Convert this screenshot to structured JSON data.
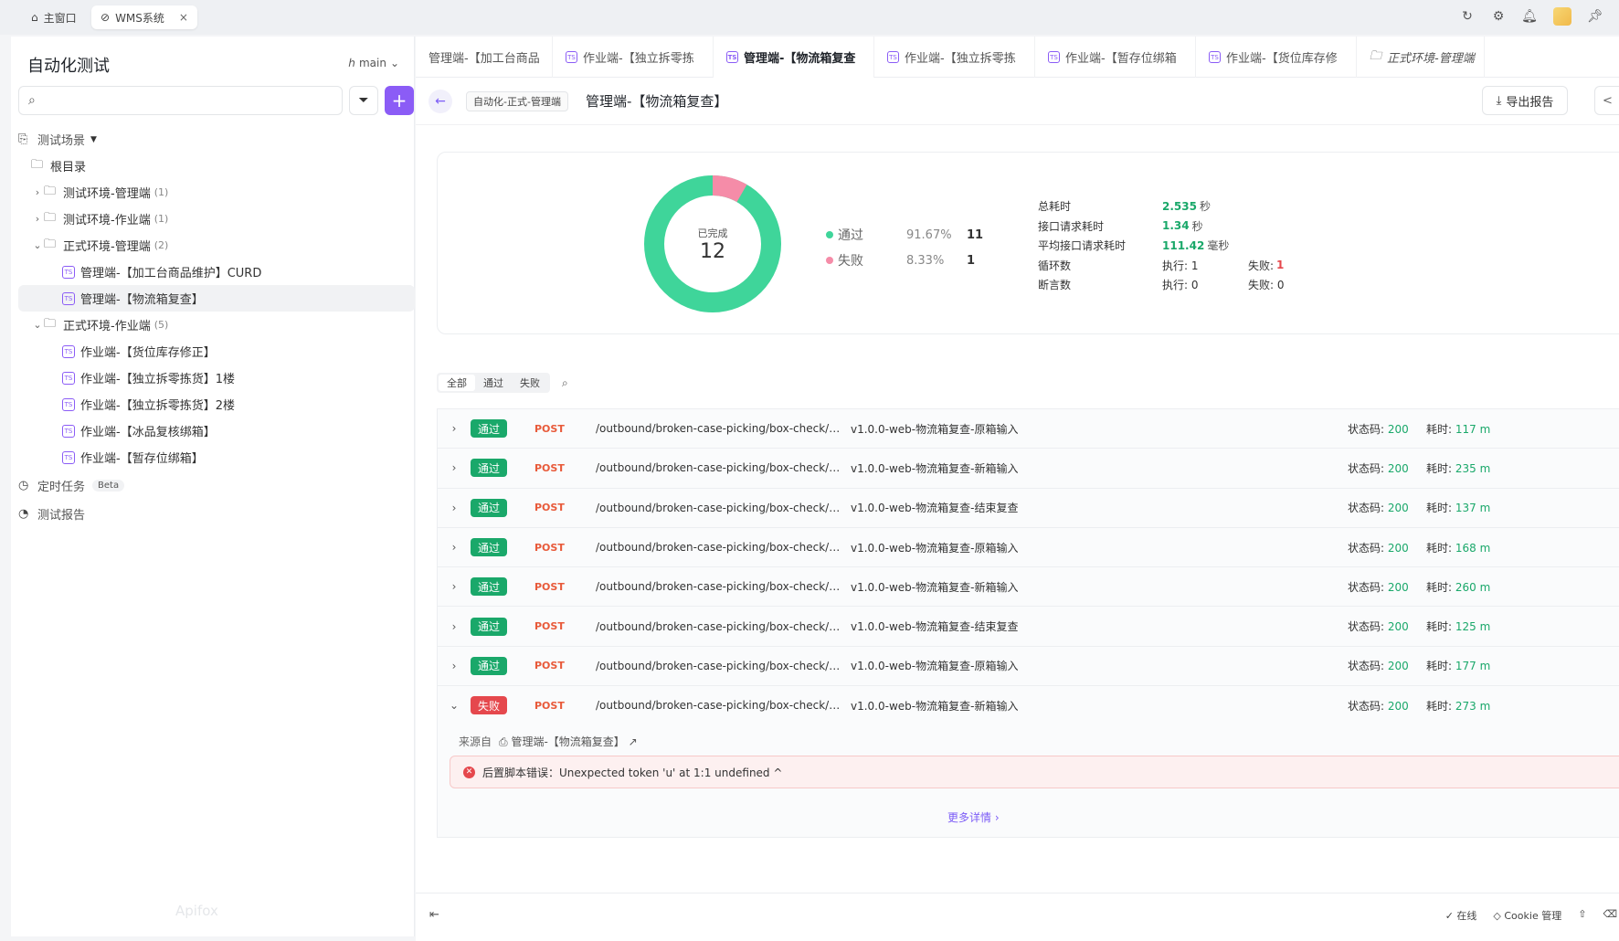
{
  "window_tabs": [
    {
      "label": "主窗口",
      "icon": "home-icon"
    },
    {
      "label": "WMS系统",
      "icon": "link-icon",
      "close": "×"
    }
  ],
  "sidebar": {
    "title": "自动化测试",
    "branch": "main",
    "search_placeholder": "",
    "tree": {
      "root_section": "测试场景",
      "root_dir": "根目录",
      "folders": [
        {
          "label": "测试环境-管理端",
          "count": "(1)",
          "expanded": false
        },
        {
          "label": "测试环境-作业端",
          "count": "(1)",
          "expanded": false
        },
        {
          "label": "正式环境-管理端",
          "count": "(2)",
          "expanded": true
        },
        {
          "label": "正式环境-作业端",
          "count": "(5)",
          "expanded": true
        }
      ],
      "items_mgmt": [
        "管理端-【加工台商品维护】CURD",
        "管理端-【物流箱复查】"
      ],
      "items_ops": [
        "作业端-【货位库存修正】",
        "作业端-【独立拆零拣货】1楼",
        "作业端-【独立拆零拣货】2楼",
        "作业端-【冰品复核绑箱】",
        "作业端-【暂存位绑箱】"
      ]
    },
    "scheduled": "定时任务",
    "beta": "Beta",
    "reports": "测试报告",
    "watermark": "Apifox"
  },
  "tabs": [
    {
      "label": "管理端-【加工台商品",
      "active": false,
      "type": "plain"
    },
    {
      "label": "作业端-【独立拆零拣",
      "active": false,
      "type": "ts"
    },
    {
      "label": "管理端-【物流箱复查",
      "active": true,
      "type": "ts"
    },
    {
      "label": "作业端-【独立拆零拣",
      "active": false,
      "type": "ts"
    },
    {
      "label": "作业端-【暂存位绑箱",
      "active": false,
      "type": "ts"
    },
    {
      "label": "作业端-【货位库存修",
      "active": false,
      "type": "ts"
    },
    {
      "label": "正式环境-管理端",
      "active": false,
      "type": "folder"
    }
  ],
  "header": {
    "env_chip": "自动化-正式-管理端",
    "title": "管理端-【物流箱复查】",
    "export_label": "导出报告"
  },
  "summary": {
    "done_label": "已完成",
    "total": "12",
    "pass": {
      "label": "通过",
      "pct": "91.67%",
      "count": "11",
      "color": "#3fd59a"
    },
    "fail": {
      "label": "失败",
      "pct": "8.33%",
      "count": "1",
      "color": "#f58ca8"
    },
    "stats": {
      "total_time_label": "总耗时",
      "total_time": "2.535",
      "total_time_unit": "秒",
      "req_time_label": "接口请求耗时",
      "req_time": "1.34",
      "req_time_unit": "秒",
      "avg_time_label": "平均接口请求耗时",
      "avg_time": "111.42",
      "avg_time_unit": "毫秒",
      "loop_label": "循环数",
      "loop_exec": "执行: 1",
      "loop_fail_label": "失败:",
      "loop_fail": "1",
      "assert_label": "断言数",
      "assert_exec": "执行: 0",
      "assert_fail": "失败: 0"
    }
  },
  "filters": [
    "全部",
    "通过",
    "失败"
  ],
  "requests": [
    {
      "status": "通过",
      "method": "POST",
      "path": "/outbound/broken-case-picking/box-check/in...",
      "name": "v1.0.0-web-物流箱复查-原箱输入",
      "code_label": "状态码:",
      "code": "200",
      "dur_label": "耗时:",
      "dur": "117 m"
    },
    {
      "status": "通过",
      "method": "POST",
      "path": "/outbound/broken-case-picking/box-check/in...",
      "name": "v1.0.0-web-物流箱复查-新箱输入",
      "code_label": "状态码:",
      "code": "200",
      "dur_label": "耗时:",
      "dur": "235 m"
    },
    {
      "status": "通过",
      "method": "POST",
      "path": "/outbound/broken-case-picking/box-check/end",
      "name": "v1.0.0-web-物流箱复查-结束复查",
      "code_label": "状态码:",
      "code": "200",
      "dur_label": "耗时:",
      "dur": "137 m"
    },
    {
      "status": "通过",
      "method": "POST",
      "path": "/outbound/broken-case-picking/box-check/in...",
      "name": "v1.0.0-web-物流箱复查-原箱输入",
      "code_label": "状态码:",
      "code": "200",
      "dur_label": "耗时:",
      "dur": "168 m"
    },
    {
      "status": "通过",
      "method": "POST",
      "path": "/outbound/broken-case-picking/box-check/in...",
      "name": "v1.0.0-web-物流箱复查-新箱输入",
      "code_label": "状态码:",
      "code": "200",
      "dur_label": "耗时:",
      "dur": "260 m"
    },
    {
      "status": "通过",
      "method": "POST",
      "path": "/outbound/broken-case-picking/box-check/end",
      "name": "v1.0.0-web-物流箱复查-结束复查",
      "code_label": "状态码:",
      "code": "200",
      "dur_label": "耗时:",
      "dur": "125 m"
    },
    {
      "status": "通过",
      "method": "POST",
      "path": "/outbound/broken-case-picking/box-check/in...",
      "name": "v1.0.0-web-物流箱复查-原箱输入",
      "code_label": "状态码:",
      "code": "200",
      "dur_label": "耗时:",
      "dur": "177 m"
    },
    {
      "status": "失败",
      "method": "POST",
      "path": "/outbound/broken-case-picking/box-check/in...",
      "name": "v1.0.0-web-物流箱复查-新箱输入",
      "code_label": "状态码:",
      "code": "200",
      "dur_label": "耗时:",
      "dur": "273 m"
    }
  ],
  "detail": {
    "source_label": "来源自",
    "source_link": "管理端-【物流箱复查】",
    "error": "后置脚本错误：Unexpected token 'u' at 1:1 undefined ^",
    "more": "更多详情 ›"
  },
  "footer": {
    "online": "在线",
    "cookie": "Cookie 管理"
  }
}
